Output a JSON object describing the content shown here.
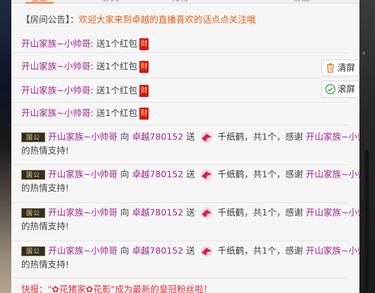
{
  "tabs": [
    {
      "label": "全部",
      "active": true
    },
    {
      "label": "聊天",
      "active": false
    },
    {
      "label": "礼物",
      "active": false
    },
    {
      "label": "",
      "active": false
    },
    {
      "label": "粉丝",
      "active": false
    }
  ],
  "notice": {
    "tag": "【房间公告】：",
    "message": "欢迎大家来到卓越的直播喜欢的话点点关注哦"
  },
  "redpacket_messages": [
    {
      "user": "开山家族~小帅哥",
      "text": ": 送1个红包",
      "icon_char": "财"
    },
    {
      "user": "开山家族~小帅哥",
      "text": ": 送1个红包",
      "icon_char": "财"
    },
    {
      "user": "开山家族~小帅哥",
      "text": ": 送1个红包",
      "icon_char": "财"
    },
    {
      "user": "开山家族~小帅哥",
      "text": ": 送1个红包",
      "icon_char": "财"
    }
  ],
  "gift_messages": [
    {
      "badge": "国公",
      "user": "开山家族~小帅哥",
      "to": "向",
      "anchor": "卓越780152",
      "send": "送",
      "gift": "千纸鹤",
      "count_text": "，共1个，感谢",
      "thanks_user": "开山家族~小帅哥",
      "tail": "的热情支持!"
    },
    {
      "badge": "国公",
      "user": "开山家族~小帅哥",
      "to": "向",
      "anchor": "卓越780152",
      "send": "送",
      "gift": "千纸鹤",
      "count_text": "，共1个，感谢",
      "thanks_user": "开山家族~小帅哥",
      "tail": "的热情支持!"
    },
    {
      "badge": "国公",
      "user": "开山家族~小帅哥",
      "to": "向",
      "anchor": "卓越780152",
      "send": "送",
      "gift": "千纸鹤",
      "count_text": "，共1个，感谢",
      "thanks_user": "开山家族~小帅哥",
      "tail": "的热情支持!"
    },
    {
      "badge": "国公",
      "user": "开山家族~小帅哥",
      "to": "向",
      "anchor": "卓越780152",
      "send": "送",
      "gift": "千纸鹤",
      "count_text": "，共1个，感谢",
      "thanks_user": "开山家族~小帅哥",
      "tail": "的热情支持!"
    }
  ],
  "buttons": {
    "clear_label": "清屏",
    "scroll_label": "滚屏"
  },
  "flash": {
    "text": "快报：\"✿花猪家✿花影\"成为最新的皇冠粉丝啦！"
  },
  "colors": {
    "accent": "#e8541d",
    "username": "#a02a8f",
    "flash": "#e0313b"
  }
}
